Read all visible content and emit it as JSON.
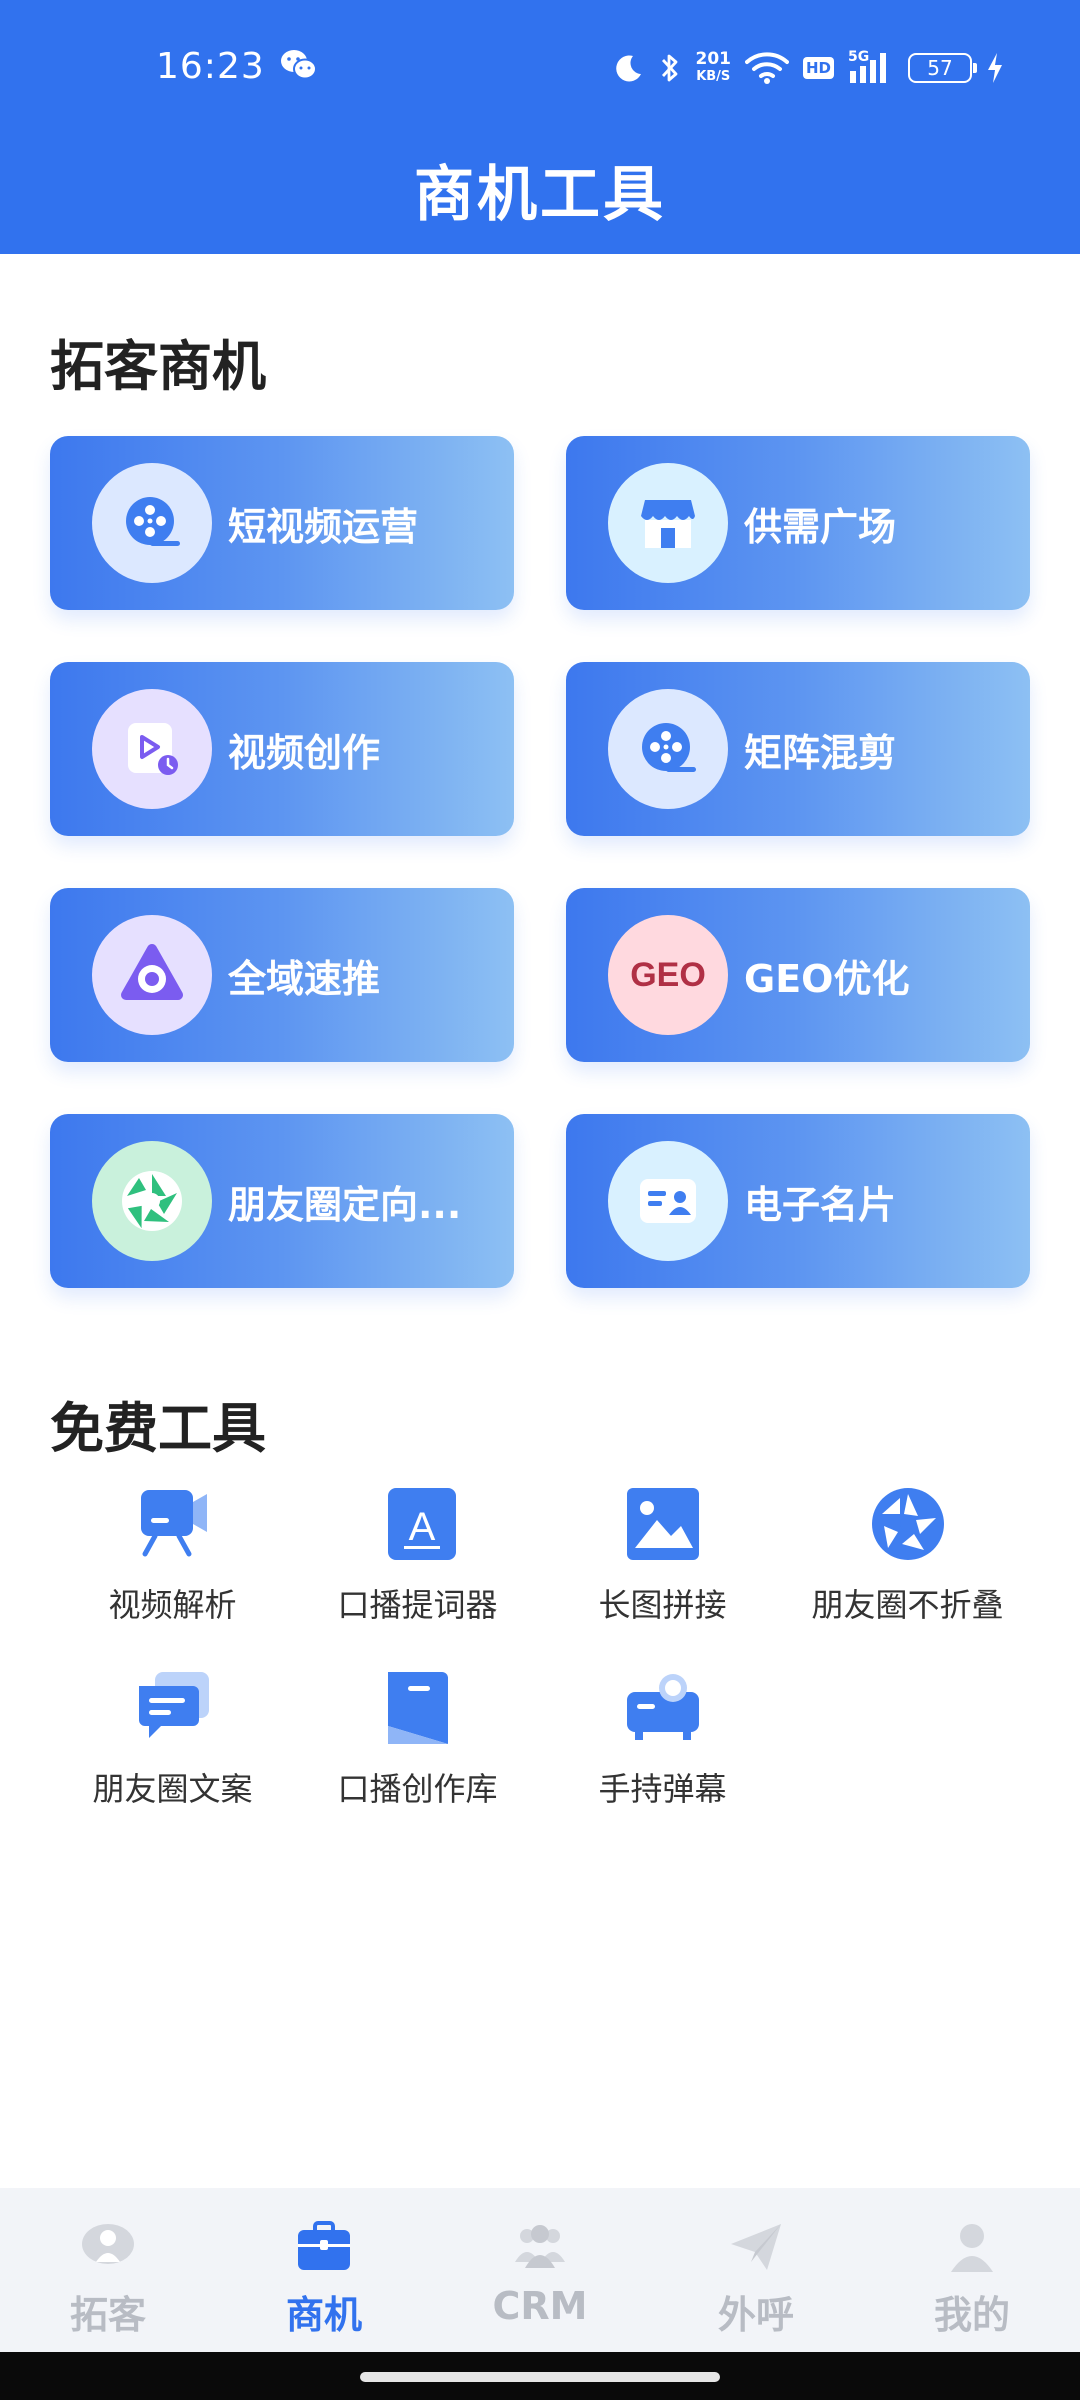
{
  "status_bar": {
    "time": "16:23",
    "net_speed_value": "201",
    "net_speed_unit": "KB/S",
    "hd_badge": "HD",
    "signal_label": "5G",
    "battery": "57"
  },
  "header": {
    "title": "商机工具"
  },
  "section1": {
    "title": "拓客商机",
    "cards": [
      {
        "label": "短视频运营",
        "icon": "film-reel-icon",
        "icon_bg": "#dce8ff"
      },
      {
        "label": "供需广场",
        "icon": "storefront-icon",
        "icon_bg": "#d9f1ff"
      },
      {
        "label": "视频创作",
        "icon": "video-play-icon",
        "icon_bg": "#e6e0ff"
      },
      {
        "label": "矩阵混剪",
        "icon": "film-reel-icon",
        "icon_bg": "#dce8ff"
      },
      {
        "label": "全域速推",
        "icon": "target-icon",
        "icon_bg": "#e6e0ff"
      },
      {
        "label": "GEO优化",
        "icon": "geo-text-icon",
        "icon_text": "GEO",
        "icon_bg": "#ffd9df"
      },
      {
        "label": "朋友圈定向...",
        "icon": "aperture-icon",
        "icon_bg": "#c9f1dc"
      },
      {
        "label": "电子名片",
        "icon": "id-card-icon",
        "icon_bg": "#d9f1ff"
      }
    ]
  },
  "section2": {
    "title": "免费工具",
    "tools": [
      {
        "label": "视频解析",
        "icon": "video-camera-icon"
      },
      {
        "label": "口播提词器",
        "icon": "teleprompter-icon",
        "icon_text": "A"
      },
      {
        "label": "长图拼接",
        "icon": "image-icon"
      },
      {
        "label": "朋友圈不折叠",
        "icon": "aperture-icon"
      },
      {
        "label": "朋友圈文案",
        "icon": "chat-bubble-icon"
      },
      {
        "label": "口播创作库",
        "icon": "bookmark-icon"
      },
      {
        "label": "手持弹幕",
        "icon": "projector-icon"
      }
    ]
  },
  "bottom_nav": {
    "items": [
      {
        "label": "拓客",
        "icon": "customer-icon",
        "active": false
      },
      {
        "label": "商机",
        "icon": "briefcase-icon",
        "active": true
      },
      {
        "label": "CRM",
        "icon": "team-icon",
        "active": false
      },
      {
        "label": "外呼",
        "icon": "paper-plane-icon",
        "active": false
      },
      {
        "label": "我的",
        "icon": "person-icon",
        "active": false
      }
    ]
  },
  "colors": {
    "primary": "#3172ee",
    "card_gradient_start": "#3d78ee",
    "card_gradient_end": "#8dc0f3",
    "icon_blue": "#3f7ef0",
    "nav_inactive": "#b8bcc4"
  }
}
